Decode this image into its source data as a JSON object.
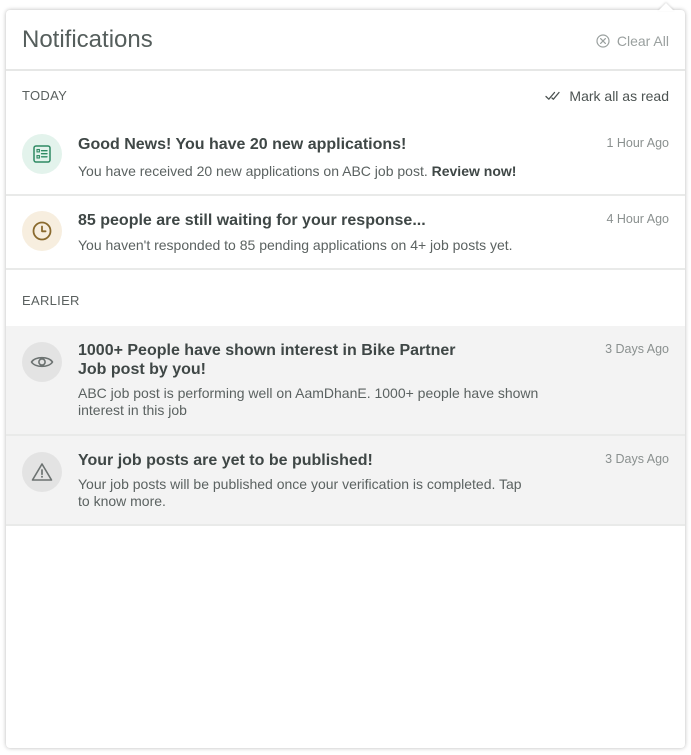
{
  "header": {
    "title": "Notifications",
    "clear_all_label": "Clear All"
  },
  "today": {
    "label": "TODAY",
    "mark_all_read_label": "Mark all as read",
    "items": [
      {
        "title": "Good News! You have 20 new applications!",
        "body": "You have received 20 new applications on ABC job post.",
        "link": "Review now!",
        "time": "1 Hour Ago",
        "icon": "applications-list-icon"
      },
      {
        "title": "85 people are still waiting for your response...",
        "body": "You haven't responded to 85 pending applications on 4+ job posts yet.",
        "time": "4 Hour Ago",
        "icon": "clock-icon"
      }
    ]
  },
  "earlier": {
    "label": "EARLIER",
    "items": [
      {
        "title_line1": "1000+ People have shown interest in Bike Partner",
        "title_line2": "Job post by you!",
        "body_line1": "ABC job post is performing well on AamDhanE. 1000+ people have shown",
        "body_line2": "interest in this job",
        "time": "3 Days Ago",
        "icon": "eye-icon"
      },
      {
        "title": "Your job posts are yet to be published!",
        "body_line1": "Your job posts will be published once your verification is completed. Tap",
        "body_line2": "to know more.",
        "time": "3 Days Ago",
        "icon": "warning-icon"
      }
    ]
  },
  "colors": {
    "green_icon_bg": "#e3f3ec",
    "green_icon": "#2e8a63",
    "amber_icon_bg": "#f7eedf",
    "amber_icon": "#8a6a2e",
    "read_bg": "#f3f3f3"
  }
}
